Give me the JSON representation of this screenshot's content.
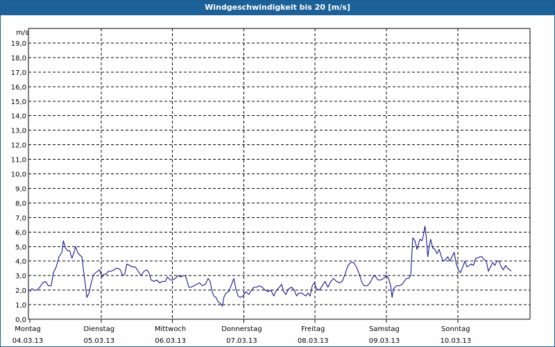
{
  "window": {
    "title": "Windgeschwindigkeit bis 20 [m/s]"
  },
  "chart_data": {
    "type": "line",
    "title": "Windgeschwindigkeit bis 20 [m/s]",
    "ylabel": "m/s",
    "ylim": [
      0,
      20
    ],
    "xlim": [
      0,
      7
    ],
    "grid": true,
    "y_ticks": [
      "0,0",
      "1,0",
      "2,0",
      "3,0",
      "4,0",
      "5,0",
      "6,0",
      "7,0",
      "8,0",
      "9,0",
      "10,0",
      "11,0",
      "12,0",
      "13,0",
      "14,0",
      "15,0",
      "16,0",
      "17,0",
      "18,0",
      "19,0"
    ],
    "x_ticks": [
      {
        "day": "Montag",
        "date": "04.03.13"
      },
      {
        "day": "Dienstag",
        "date": "05.03.13"
      },
      {
        "day": "Mittwoch",
        "date": "06.03.13"
      },
      {
        "day": "Donnerstag",
        "date": "07.03.13"
      },
      {
        "day": "Freitag",
        "date": "08.03.13"
      },
      {
        "day": "Samstag",
        "date": "09.03.13"
      },
      {
        "day": "Sonntag",
        "date": "10.03.13"
      }
    ],
    "series": [
      {
        "color": "#00008b",
        "points": [
          [
            0.0,
            1.9
          ],
          [
            0.03,
            2.1
          ],
          [
            0.06,
            2.0
          ],
          [
            0.1,
            2.0
          ],
          [
            0.14,
            2.2
          ],
          [
            0.18,
            2.5
          ],
          [
            0.22,
            2.6
          ],
          [
            0.26,
            2.3
          ],
          [
            0.3,
            2.3
          ],
          [
            0.33,
            3.2
          ],
          [
            0.37,
            3.6
          ],
          [
            0.41,
            4.3
          ],
          [
            0.45,
            4.6
          ],
          [
            0.47,
            5.4
          ],
          [
            0.5,
            4.9
          ],
          [
            0.53,
            4.7
          ],
          [
            0.56,
            4.7
          ],
          [
            0.59,
            4.2
          ],
          [
            0.62,
            4.6
          ],
          [
            0.64,
            5.0
          ],
          [
            0.67,
            4.6
          ],
          [
            0.7,
            4.4
          ],
          [
            0.73,
            4.3
          ],
          [
            0.76,
            3.1
          ],
          [
            0.78,
            2.3
          ],
          [
            0.8,
            1.5
          ],
          [
            0.83,
            1.8
          ],
          [
            0.86,
            2.5
          ],
          [
            0.89,
            3.0
          ],
          [
            0.92,
            3.2
          ],
          [
            0.95,
            3.3
          ],
          [
            0.98,
            3.4
          ],
          [
            1.01,
            2.9
          ],
          [
            1.04,
            3.1
          ],
          [
            1.07,
            3.1
          ],
          [
            1.1,
            3.3
          ],
          [
            1.14,
            3.3
          ],
          [
            1.18,
            3.4
          ],
          [
            1.21,
            3.5
          ],
          [
            1.24,
            3.5
          ],
          [
            1.27,
            3.4
          ],
          [
            1.3,
            3.0
          ],
          [
            1.33,
            3.1
          ],
          [
            1.36,
            3.8
          ],
          [
            1.4,
            3.7
          ],
          [
            1.44,
            3.6
          ],
          [
            1.48,
            3.6
          ],
          [
            1.52,
            3.3
          ],
          [
            1.56,
            3.0
          ],
          [
            1.6,
            3.3
          ],
          [
            1.64,
            3.4
          ],
          [
            1.67,
            3.2
          ],
          [
            1.7,
            2.7
          ],
          [
            1.74,
            2.6
          ],
          [
            1.78,
            2.7
          ],
          [
            1.82,
            2.5
          ],
          [
            1.86,
            2.6
          ],
          [
            1.9,
            2.6
          ],
          [
            1.93,
            2.9
          ],
          [
            1.97,
            2.7
          ],
          [
            2.0,
            2.7
          ],
          [
            2.04,
            2.8
          ],
          [
            2.08,
            3.0
          ],
          [
            2.12,
            2.9
          ],
          [
            2.15,
            3.0
          ],
          [
            2.18,
            3.0
          ],
          [
            2.2,
            2.7
          ],
          [
            2.23,
            2.2
          ],
          [
            2.26,
            2.2
          ],
          [
            2.3,
            2.3
          ],
          [
            2.34,
            2.4
          ],
          [
            2.38,
            2.5
          ],
          [
            2.42,
            2.3
          ],
          [
            2.46,
            2.4
          ],
          [
            2.5,
            2.8
          ],
          [
            2.53,
            2.6
          ],
          [
            2.55,
            2.0
          ],
          [
            2.58,
            1.6
          ],
          [
            2.61,
            1.5
          ],
          [
            2.64,
            1.2
          ],
          [
            2.67,
            1.1
          ],
          [
            2.7,
            0.9
          ],
          [
            2.72,
            1.5
          ],
          [
            2.75,
            1.8
          ],
          [
            2.79,
            1.9
          ],
          [
            2.83,
            2.4
          ],
          [
            2.86,
            2.8
          ],
          [
            2.89,
            2.1
          ],
          [
            2.92,
            1.6
          ],
          [
            2.95,
            1.5
          ],
          [
            2.99,
            1.6
          ],
          [
            3.03,
            1.9
          ],
          [
            3.07,
            1.7
          ],
          [
            3.11,
            2.0
          ],
          [
            3.14,
            2.2
          ],
          [
            3.18,
            2.2
          ],
          [
            3.22,
            2.3
          ],
          [
            3.26,
            2.2
          ],
          [
            3.3,
            2.0
          ],
          [
            3.34,
            1.9
          ],
          [
            3.38,
            2.0
          ],
          [
            3.42,
            1.6
          ],
          [
            3.46,
            2.0
          ],
          [
            3.5,
            2.2
          ],
          [
            3.53,
            2.4
          ],
          [
            3.56,
            1.9
          ],
          [
            3.59,
            1.7
          ],
          [
            3.63,
            2.1
          ],
          [
            3.67,
            2.2
          ],
          [
            3.71,
            2.0
          ],
          [
            3.74,
            1.6
          ],
          [
            3.77,
            1.8
          ],
          [
            3.81,
            1.8
          ],
          [
            3.84,
            1.7
          ],
          [
            3.87,
            1.6
          ],
          [
            3.9,
            1.8
          ],
          [
            3.93,
            1.6
          ],
          [
            3.96,
            2.3
          ],
          [
            3.99,
            2.5
          ],
          [
            4.02,
            2.1
          ],
          [
            4.06,
            2.0
          ],
          [
            4.1,
            2.3
          ],
          [
            4.14,
            2.6
          ],
          [
            4.18,
            2.2
          ],
          [
            4.22,
            2.6
          ],
          [
            4.26,
            2.8
          ],
          [
            4.3,
            2.6
          ],
          [
            4.34,
            2.5
          ],
          [
            4.38,
            2.6
          ],
          [
            4.42,
            3.1
          ],
          [
            4.46,
            3.7
          ],
          [
            4.5,
            3.9
          ],
          [
            4.54,
            3.9
          ],
          [
            4.58,
            3.6
          ],
          [
            4.62,
            3.1
          ],
          [
            4.66,
            2.5
          ],
          [
            4.69,
            2.3
          ],
          [
            4.73,
            2.3
          ],
          [
            4.77,
            2.5
          ],
          [
            4.81,
            2.9
          ],
          [
            4.84,
            3.0
          ],
          [
            4.88,
            2.7
          ],
          [
            4.92,
            2.7
          ],
          [
            4.96,
            2.8
          ],
          [
            5.0,
            3.0
          ],
          [
            5.03,
            2.8
          ],
          [
            5.06,
            2.3
          ],
          [
            5.08,
            1.5
          ],
          [
            5.1,
            2.1
          ],
          [
            5.14,
            2.3
          ],
          [
            5.18,
            2.3
          ],
          [
            5.22,
            2.4
          ],
          [
            5.25,
            2.6
          ],
          [
            5.28,
            2.8
          ],
          [
            5.31,
            2.8
          ],
          [
            5.34,
            3.0
          ],
          [
            5.37,
            5.6
          ],
          [
            5.4,
            5.4
          ],
          [
            5.43,
            4.8
          ],
          [
            5.45,
            5.2
          ],
          [
            5.47,
            5.5
          ],
          [
            5.5,
            5.4
          ],
          [
            5.52,
            5.8
          ],
          [
            5.54,
            6.4
          ],
          [
            5.56,
            5.6
          ],
          [
            5.58,
            4.3
          ],
          [
            5.6,
            5.0
          ],
          [
            5.62,
            5.5
          ],
          [
            5.65,
            4.9
          ],
          [
            5.68,
            4.8
          ],
          [
            5.71,
            4.5
          ],
          [
            5.74,
            4.8
          ],
          [
            5.77,
            4.3
          ],
          [
            5.8,
            4.0
          ],
          [
            5.83,
            4.1
          ],
          [
            5.86,
            4.3
          ],
          [
            5.89,
            4.0
          ],
          [
            5.92,
            4.3
          ],
          [
            5.95,
            4.6
          ],
          [
            5.98,
            3.8
          ],
          [
            6.01,
            3.4
          ],
          [
            6.04,
            3.2
          ],
          [
            6.07,
            3.6
          ],
          [
            6.1,
            4.0
          ],
          [
            6.13,
            3.6
          ],
          [
            6.16,
            3.7
          ],
          [
            6.19,
            3.8
          ],
          [
            6.22,
            3.7
          ],
          [
            6.25,
            4.2
          ],
          [
            6.28,
            4.2
          ],
          [
            6.31,
            4.3
          ],
          [
            6.34,
            4.3
          ],
          [
            6.37,
            4.1
          ],
          [
            6.4,
            4.0
          ],
          [
            6.43,
            3.3
          ],
          [
            6.46,
            3.6
          ],
          [
            6.49,
            3.9
          ],
          [
            6.52,
            3.7
          ],
          [
            6.55,
            4.0
          ],
          [
            6.58,
            4.0
          ],
          [
            6.61,
            3.6
          ],
          [
            6.64,
            3.4
          ],
          [
            6.67,
            3.7
          ],
          [
            6.7,
            3.5
          ],
          [
            6.73,
            3.4
          ],
          [
            6.75,
            3.3
          ]
        ]
      }
    ]
  }
}
